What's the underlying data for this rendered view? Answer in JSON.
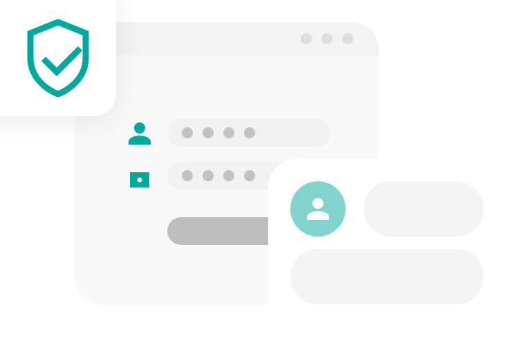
{
  "colors": {
    "accent": "#00a99d",
    "accent_light": "#81d4cc",
    "placeholder_dot": "#c2c2c2",
    "button": "#bdbdbd"
  },
  "icons": {
    "shield": "shield-check-icon",
    "user": "user-icon",
    "lock": "lock-icon",
    "avatar": "avatar-user-icon"
  },
  "login_form": {
    "username_mask_dots": 4,
    "password_mask_dots": 4
  },
  "window": {
    "control_dots": 3
  }
}
